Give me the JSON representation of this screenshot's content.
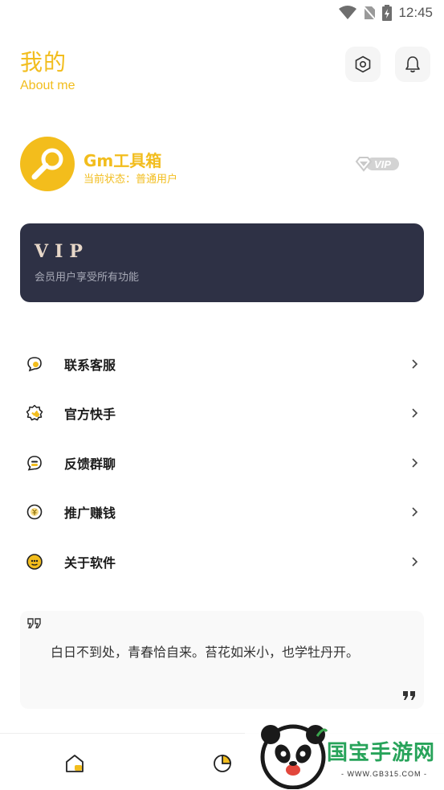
{
  "status_bar": {
    "time": "12:45"
  },
  "header": {
    "title": "我的",
    "subtitle": "About me"
  },
  "profile": {
    "app_name": "Gm工具箱",
    "status_line": "当前状态：普通用户",
    "badge": "VIP"
  },
  "vip_card": {
    "title": "VIP",
    "description": "会员用户享受所有功能"
  },
  "menu": {
    "items": [
      {
        "label": "联系客服",
        "icon": "customer-service-icon"
      },
      {
        "label": "官方快手",
        "icon": "kuaishou-badge-icon"
      },
      {
        "label": "反馈群聊",
        "icon": "chat-group-icon"
      },
      {
        "label": "推广赚钱",
        "icon": "coin-icon"
      },
      {
        "label": "关于软件",
        "icon": "smiley-info-icon"
      }
    ]
  },
  "quote": {
    "text": "白日不到处，青春恰自来。苔花如米小，也学牡丹开。"
  },
  "watermark": {
    "brand": "国宝手游网",
    "url": "- WWW.GB315.COM -"
  },
  "colors": {
    "accent": "#f2bd1d",
    "vip_card": "#2e3145",
    "vip_text": "#e7d7c8"
  }
}
